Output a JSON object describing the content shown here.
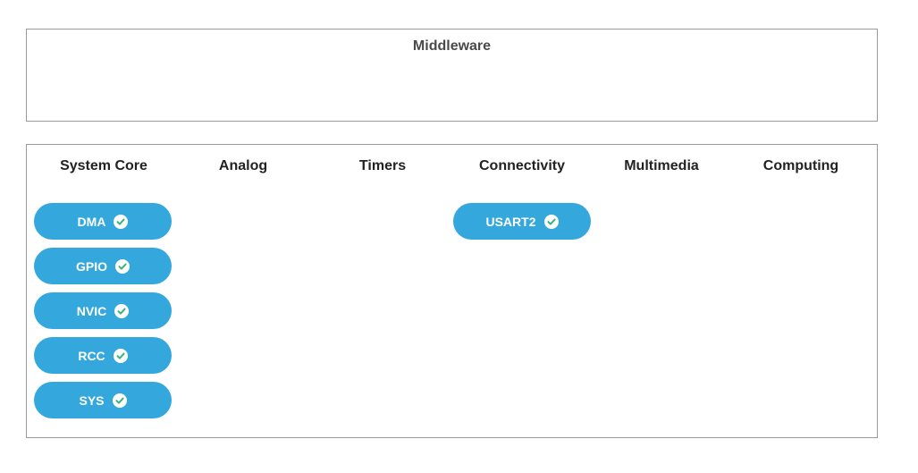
{
  "middleware": {
    "title": "Middleware"
  },
  "categories": [
    {
      "name": "System Core",
      "peripherals": [
        {
          "label": "DMA",
          "status_icon": "check-circle-icon"
        },
        {
          "label": "GPIO",
          "status_icon": "check-circle-icon"
        },
        {
          "label": "NVIC",
          "status_icon": "check-circle-icon"
        },
        {
          "label": "RCC",
          "status_icon": "check-circle-icon"
        },
        {
          "label": "SYS",
          "status_icon": "check-circle-icon"
        }
      ]
    },
    {
      "name": "Analog",
      "peripherals": []
    },
    {
      "name": "Timers",
      "peripherals": []
    },
    {
      "name": "Connectivity",
      "peripherals": [
        {
          "label": "USART2",
          "status_icon": "check-circle-icon"
        }
      ]
    },
    {
      "name": "Multimedia",
      "peripherals": []
    },
    {
      "name": "Computing",
      "peripherals": []
    }
  ],
  "colors": {
    "button": "#34a8dc",
    "check": "#3bb27a",
    "border": "#9a9a9a"
  }
}
